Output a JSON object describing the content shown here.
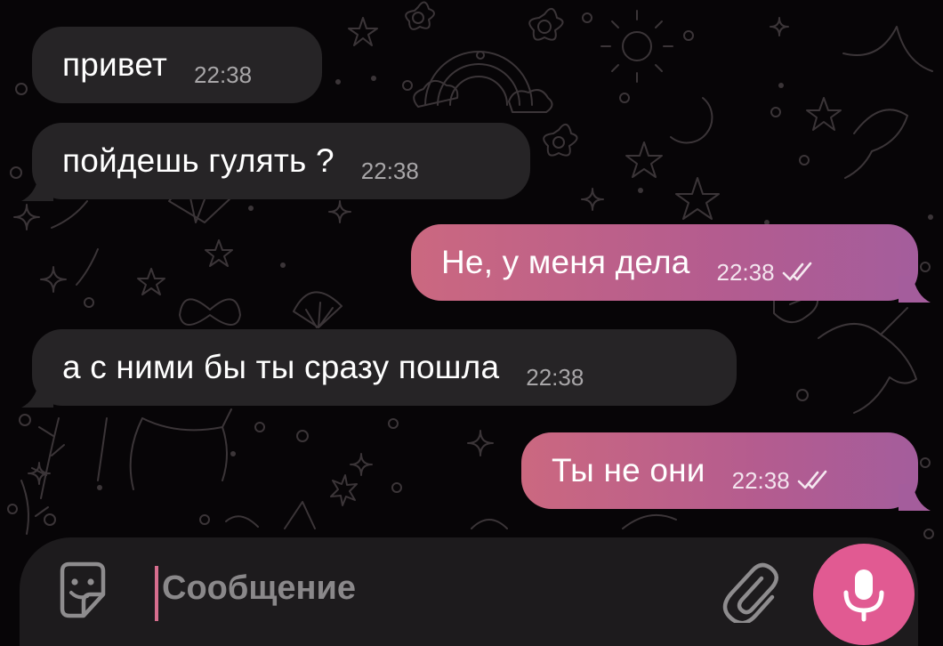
{
  "messages": [
    {
      "direction": "in",
      "text": "привет",
      "time": "22:38"
    },
    {
      "direction": "in",
      "text": "пойдешь гулять ?",
      "time": "22:38"
    },
    {
      "direction": "out",
      "text": "Не, у меня дела",
      "time": "22:38",
      "status": "read"
    },
    {
      "direction": "in",
      "text": "а с ними бы ты сразу пошла",
      "time": "22:38"
    },
    {
      "direction": "out",
      "text": "Ты не они",
      "time": "22:38",
      "status": "read"
    }
  ],
  "composer": {
    "placeholder": "Сообщение",
    "emoji_icon": "sticker-smile-icon",
    "attach_icon": "paperclip-icon",
    "mic_icon": "microphone-icon"
  },
  "colors": {
    "background": "#070507",
    "incoming_bubble": "#262426",
    "outgoing_bubble_start": "#cb6880",
    "outgoing_bubble_end": "#a45d9c",
    "mic_button": "#e15a92",
    "caret": "#d76e8e"
  }
}
